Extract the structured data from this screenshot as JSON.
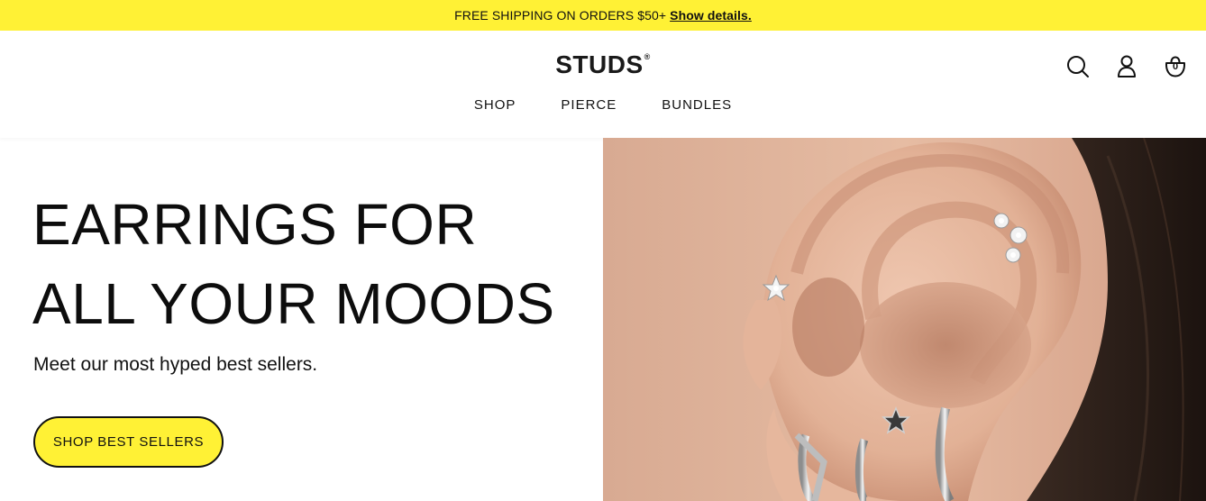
{
  "promo": {
    "text": "FREE SHIPPING ON ORDERS $50+",
    "link": "Show details."
  },
  "header": {
    "logo": "STUDS",
    "logo_mark": "®",
    "nav": [
      {
        "label": "SHOP"
      },
      {
        "label": "PIERCE"
      },
      {
        "label": "BUNDLES"
      }
    ],
    "icons": [
      "search-icon",
      "account-icon",
      "cart-icon"
    ],
    "cart_count": "0"
  },
  "hero": {
    "title_line1": "EARRINGS FOR",
    "title_line2": "ALL YOUR MOODS",
    "subtitle": "Meet our most hyped best sellers.",
    "cta": "SHOP BEST SELLERS",
    "image_alt": "close-up of an ear wearing star studs and silver hoops"
  },
  "colors": {
    "accent_yellow": "#fff135",
    "text": "#111111"
  }
}
